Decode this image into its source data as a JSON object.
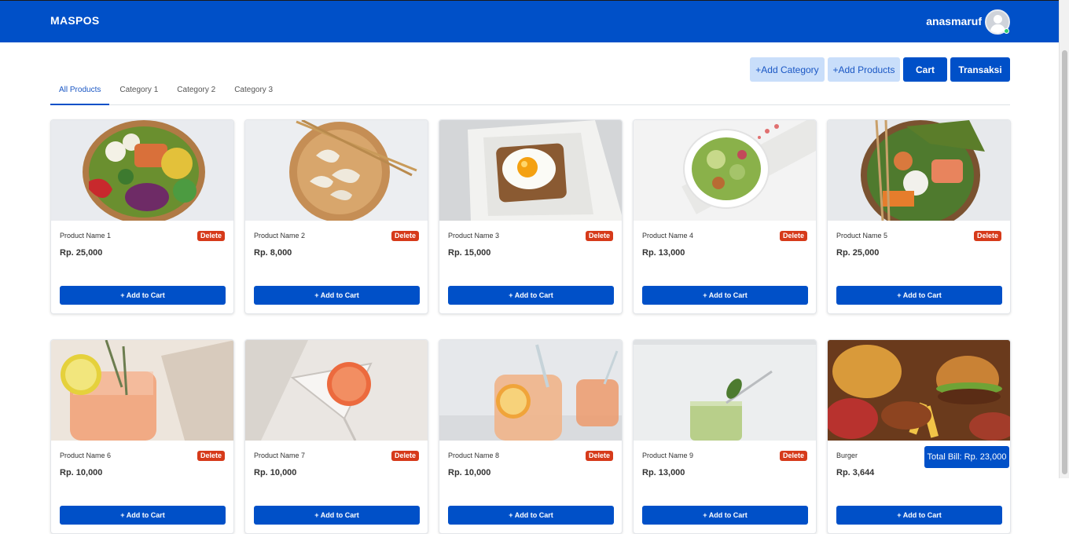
{
  "header": {
    "brand": "MASPOS",
    "username": "anasmaruf"
  },
  "actions": {
    "add_category": "+Add Category",
    "add_products": "+Add Products",
    "cart": "Cart",
    "transaksi": "Transaksi"
  },
  "tabs": [
    {
      "label": "All Products",
      "active": true
    },
    {
      "label": "Category 1",
      "active": false
    },
    {
      "label": "Category 2",
      "active": false
    },
    {
      "label": "Category 3",
      "active": false
    }
  ],
  "products": [
    {
      "name": "Product Name 1",
      "price": "Rp. 25,000",
      "image": "poke-bowl-salmon"
    },
    {
      "name": "Product Name 2",
      "price": "Rp. 8,000",
      "image": "dumplings-wooden-plate"
    },
    {
      "name": "Product Name 3",
      "price": "Rp. 15,000",
      "image": "fried-egg-toast"
    },
    {
      "name": "Product Name 4",
      "price": "Rp. 13,000",
      "image": "green-salad-bowl"
    },
    {
      "name": "Product Name 5",
      "price": "Rp. 25,000",
      "image": "sushi-bowl"
    },
    {
      "name": "Product Name 6",
      "price": "Rp. 10,000",
      "image": "citrus-cocktail"
    },
    {
      "name": "Product Name 7",
      "price": "Rp. 10,000",
      "image": "grapefruit-martini"
    },
    {
      "name": "Product Name 8",
      "price": "Rp. 10,000",
      "image": "iced-tea-lemon"
    },
    {
      "name": "Product Name 9",
      "price": "Rp. 13,000",
      "image": "matcha-smoothie"
    },
    {
      "name": "Burger",
      "price": "Rp. 3,644",
      "image": "burger-fast-food"
    }
  ],
  "card_labels": {
    "delete": "Delete",
    "add_to_cart": "+ Add to Cart"
  },
  "total_bill": "Total Bill: Rp. 23,000",
  "colors": {
    "primary": "#0050c8",
    "danger": "#d63a1a",
    "light_button": "#c9defa"
  }
}
